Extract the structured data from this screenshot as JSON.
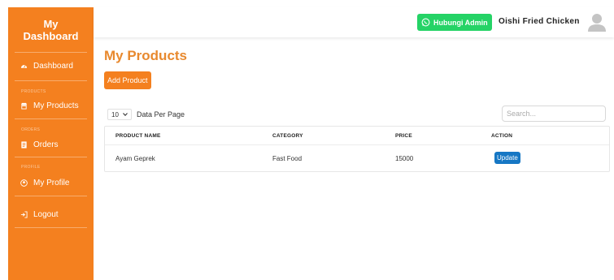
{
  "sidebar": {
    "brand_line1": "My",
    "brand_line2": "Dashboard",
    "dashboard": "Dashboard",
    "section_products": "PRODUCTS",
    "my_products": "My Products",
    "section_orders": "ORDERS",
    "orders": "Orders",
    "section_profile": "PROFILE",
    "my_profile": "My Profile",
    "logout": "Logout"
  },
  "topbar": {
    "whatsapp_label": "Hubungi Admin",
    "shop_name": "Oishi Fried Chicken"
  },
  "main": {
    "title": "My Products",
    "add_button": "Add Product",
    "per_page_value": "10",
    "per_page_label": "Data Per Page",
    "search_placeholder": "Search..."
  },
  "table": {
    "headers": [
      "PRODUCT NAME",
      "CATEGORY",
      "PRICE",
      "ACTION"
    ],
    "rows": [
      {
        "name": "Ayam Geprek",
        "category": "Fast Food",
        "price": "15000",
        "action": "Update"
      }
    ]
  },
  "colors": {
    "sidebar": "#f4801f",
    "title": "#e8892e",
    "whatsapp": "#25d366",
    "update": "#1677c4"
  }
}
